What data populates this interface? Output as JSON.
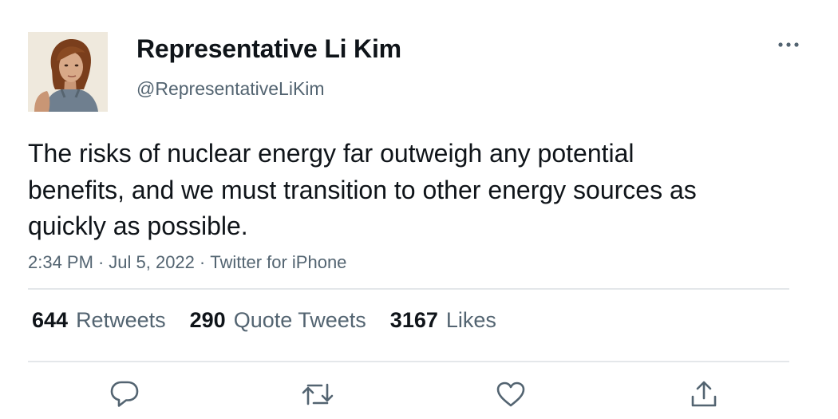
{
  "author": {
    "display_name": "Representative Li Kim",
    "handle": "@RepresentativeLiKim",
    "avatar_icon": "profile-photo"
  },
  "tweet": {
    "text": "The risks of nuclear energy far outweigh any potential benefits, and we must transition to other energy sources as quickly as possible.",
    "time": "2:34 PM",
    "date": "Jul 5, 2022",
    "source": "Twitter for iPhone",
    "separator": "·"
  },
  "stats": {
    "retweets_count": "644",
    "retweets_label": "Retweets",
    "quotes_count": "290",
    "quotes_label": "Quote Tweets",
    "likes_count": "3167",
    "likes_label": "Likes"
  },
  "actions": {
    "reply_icon": "reply-icon",
    "retweet_icon": "retweet-icon",
    "like_icon": "heart-icon",
    "share_icon": "share-icon",
    "more_icon": "more-icon"
  },
  "colors": {
    "text_primary": "#0f1419",
    "text_secondary": "#536471",
    "divider": "#e4e7ea",
    "icon": "#536471"
  }
}
